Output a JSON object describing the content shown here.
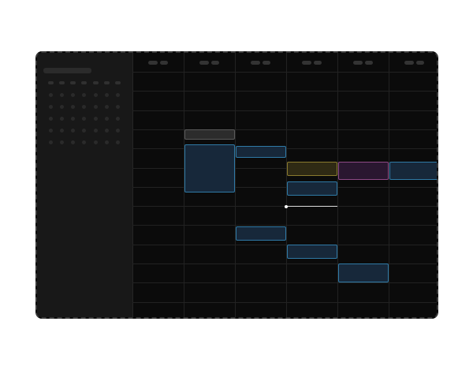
{
  "calendar": {
    "columns": 6,
    "rows": 13,
    "day_headers": [
      "",
      "",
      "",
      "",
      "",
      ""
    ]
  },
  "events": [
    {
      "col": 1,
      "row_start": 4,
      "row_span": 0.55,
      "color": "gray"
    },
    {
      "col": 1,
      "row_start": 4.8,
      "row_span": 2.5,
      "color": "blue"
    },
    {
      "col": 2,
      "row_start": 4.85,
      "row_span": 0.65,
      "color": "blue"
    },
    {
      "col": 3,
      "row_start": 5.7,
      "row_span": 0.75,
      "color": "yellow"
    },
    {
      "col": 4,
      "row_start": 5.7,
      "row_span": 0.95,
      "color": "pink"
    },
    {
      "col": 5,
      "row_start": 5.7,
      "row_span": 0.95,
      "color": "blue"
    },
    {
      "col": 3,
      "row_start": 6.7,
      "row_span": 0.75,
      "color": "blue"
    },
    {
      "col": 2,
      "row_start": 9.05,
      "row_span": 0.75,
      "color": "blue"
    },
    {
      "col": 3,
      "row_start": 10.0,
      "row_span": 0.75,
      "color": "blue"
    },
    {
      "col": 4,
      "row_start": 11.0,
      "row_span": 1.0,
      "color": "blue"
    }
  ],
  "now_indicator": {
    "col": 3,
    "row": 8.0
  },
  "colors": {
    "blue": "#2f7aa6",
    "gray": "#5a5a5a",
    "yellow": "#8a7a2e",
    "pink": "#8e4a86"
  },
  "mini_calendar": {
    "weeks": 6,
    "days": 7
  }
}
